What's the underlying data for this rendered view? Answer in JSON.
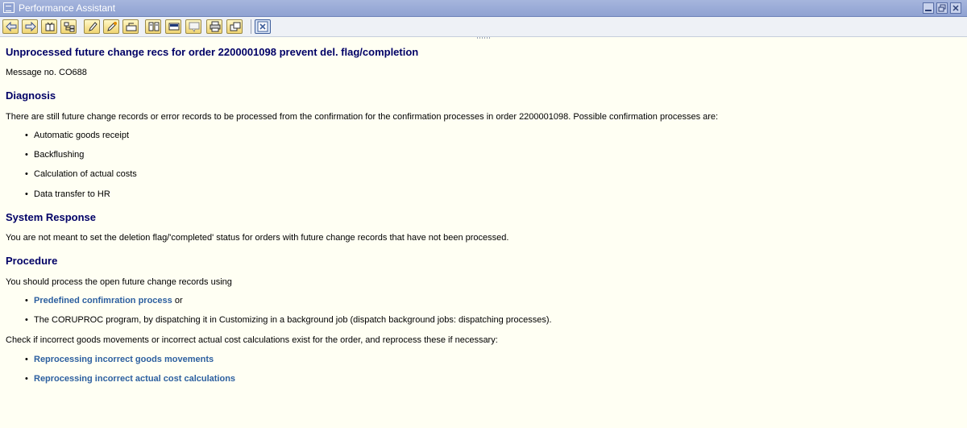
{
  "window": {
    "title": "Performance Assistant",
    "app_icon": "performance-assistant-icon",
    "controls": [
      "minimize-icon",
      "restore-icon",
      "close-icon"
    ]
  },
  "toolbar": {
    "buttons": [
      "back-icon",
      "forward-icon",
      "table-of-contents-icon",
      "hierarchy-icon",
      "edit-icon",
      "technical-info-icon",
      "exit-icon",
      "book-icon",
      "note-icon",
      "comment-icon",
      "print-icon",
      "export-icon"
    ],
    "close_button": "close-window-icon"
  },
  "message": {
    "title": "Unprocessed future change recs for order 2200001098 prevent del. flag/completion",
    "message_no": "Message no. CO688"
  },
  "diagnosis": {
    "heading": "Diagnosis",
    "text": "There are still future change records or error records to be processed from the confirmation for the confirmation processes in order 2200001098. Possible confirmation processes are:",
    "items": [
      "Automatic goods receipt",
      "Backflushing",
      "Calculation of actual costs",
      "Data transfer to HR"
    ]
  },
  "system_response": {
    "heading": "System Response",
    "text": "You are not meant to set the deletion flag/'completed' status for orders with future change records that have not been processed."
  },
  "procedure": {
    "heading": "Procedure",
    "intro": "You should process the open future change records using",
    "item1_link": "Predefined confimration process",
    "item1_suffix": " or",
    "item2": "The CORUPROC program, by dispatching it in Customizing in a background job (dispatch background jobs: dispatching processes).",
    "check_text": "Check if incorrect goods movements or incorrect actual cost calculations exist for the order, and reprocess these if necessary:",
    "links": [
      "Reprocessing incorrect goods movements",
      "Reprocessing incorrect actual cost calculations"
    ]
  }
}
